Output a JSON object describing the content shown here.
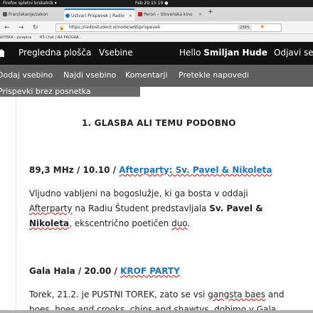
{
  "system_bar": {
    "app_name": "Firefox spletni brskalnik",
    "app_arrow": "▾",
    "clock": "Feb 20  15:19  ●"
  },
  "browser": {
    "tabs": [
      {
        "label": "Fran/iskanje/zakon",
        "active": false
      },
      {
        "label": "Ustvari Prispevek | Radio",
        "active": true
      },
      {
        "label": "Peron – Slovenska kino",
        "active": false
      }
    ],
    "tab_close_glyph": "×",
    "new_tab_glyph": "+",
    "nav": {
      "back": "←",
      "forward": "→",
      "reload": "↻"
    },
    "url": "https://radiostudent.si/node/add/prispevek",
    "zoom": "230%",
    "bookmark_star": "★",
    "bookmarks": [
      "NOTEKA - picapica",
      "RŠ Chat | NA PROGRA..."
    ]
  },
  "site_toolbar": {
    "dashboard": "Pregledna plošča",
    "content": "Vsebine",
    "greeting": "Hello ",
    "user": "Smiljan Hude",
    "logout": "Odjavi se"
  },
  "sub_menu": [
    "Dodaj vsebino",
    "Najdi vsebino",
    "Komentarji",
    "Pretekle napovedi"
  ],
  "overlap_item": "Prispevki brez posnetka",
  "content": {
    "heading": "1. GLASBA ALI TEMU PODOBNO",
    "event1": {
      "prefix": "89,3 MHz / 10.10 / ",
      "link": "Afterparty: Sv. Pavel & Nikoleta",
      "p1": "Vljudno vabljeni na bogoslužje, ki ga bosta v oddaji",
      "p2_word": "Afterparty",
      "p2_rest": " na Radiu Študent predstavljala ",
      "p2_bold": "Sv. Pavel &",
      "p3_bold": "Nikoleta",
      "p3_mid": ", ekscentrično poetičen ",
      "p3_end_sq": "duo",
      "p3_end": "."
    },
    "event2": {
      "prefix": "Gala Hala / 20.00 / ",
      "link": "KROF PARTY",
      "p1_start": "Torek, 21.2. je PUSTNI TOREK, zato se vsi ",
      "p1_sq": "gangsta baes",
      "p1_end": " and",
      "p2": "boes, hoes and crooks, chips and shawtys, dobimo v Gala"
    }
  }
}
